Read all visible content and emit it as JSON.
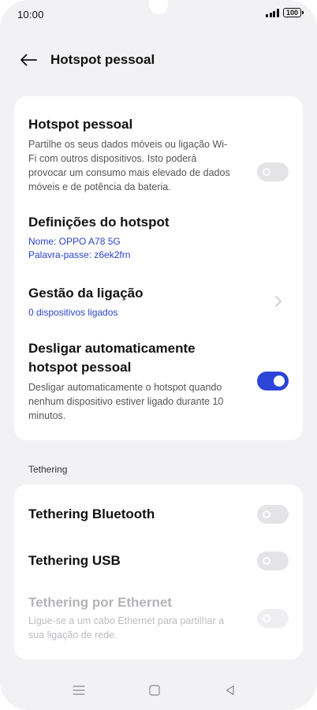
{
  "status_bar": {
    "time": "10:00",
    "battery": "100",
    "icons": [
      "signal-icon",
      "battery-icon"
    ]
  },
  "header": {
    "title": "Hotspot pessoal",
    "back_icon": "arrow-left-icon"
  },
  "hotspot_card": {
    "hotspot": {
      "title": "Hotspot pessoal",
      "description": "Partilhe os seus dados móveis ou ligação Wi-Fi com outros dispositivos. Isto poderá provocar um consumo mais elevado de dados móveis e de potência da bateria.",
      "enabled": false
    },
    "settings": {
      "title": "Definições do hotspot",
      "name": "Nome: OPPO A78 5G",
      "password": "Palavra-passe: z6ek2frn"
    },
    "connection": {
      "title": "Gestão da ligação",
      "subtitle": "0 dispositivos ligados",
      "icon": "chevron-right-icon"
    },
    "auto_off": {
      "title_line1": "Desligar automaticamente",
      "title_line2": "hotspot pessoal",
      "description": "Desligar automaticamente o hotspot quando nenhum dispositivo estiver ligado durante 10 minutos.",
      "enabled": true
    }
  },
  "tethering": {
    "section_label": "Tethering",
    "bluetooth": {
      "title": "Tethering Bluetooth",
      "enabled": false
    },
    "usb": {
      "title": "Tethering USB",
      "enabled": false
    },
    "ethernet": {
      "title": "Tethering por Ethernet",
      "description": "Ligue-se a um cabo Ethernet para partilhar a sua ligação de rede.",
      "enabled": false,
      "disabled": true
    }
  },
  "nav_bar": {
    "icons": [
      "menu-icon",
      "home-icon",
      "back-icon"
    ]
  },
  "colors": {
    "background": "#f2f2f4",
    "card": "#ffffff",
    "accent": "#2c45d6",
    "link": "#2a43c9",
    "toggle_off": "#e4e4e6"
  }
}
